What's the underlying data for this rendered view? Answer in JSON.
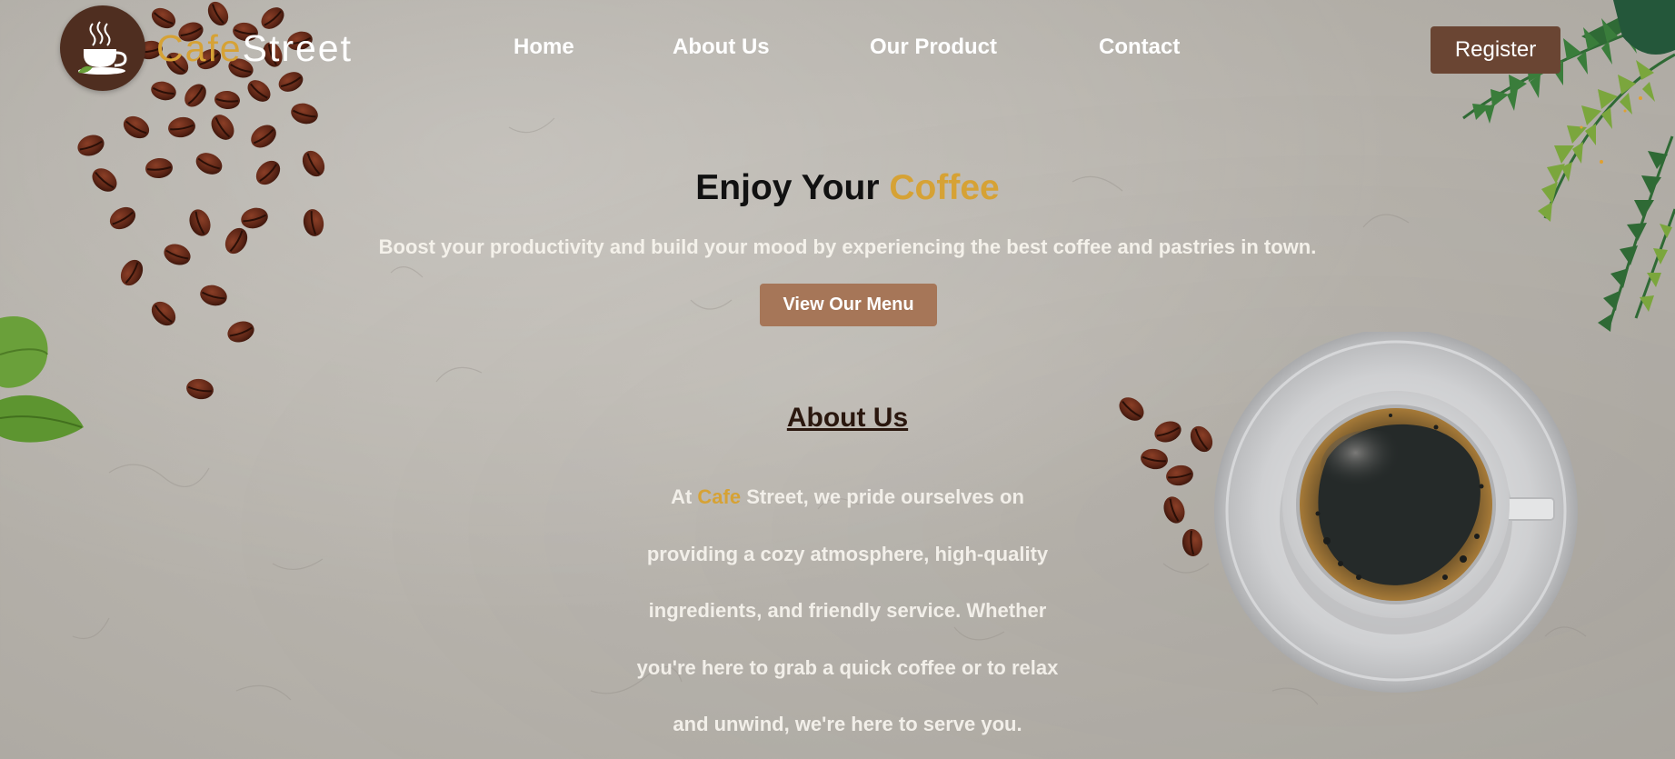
{
  "header": {
    "logo_part1": "Cafe",
    "logo_part2": "Street",
    "nav": [
      "Home",
      "About Us",
      "Our Product",
      "Contact"
    ],
    "register_label": "Register"
  },
  "hero": {
    "title_part1": "Enjoy Your ",
    "title_part2": "Coffee",
    "subtitle": "Boost your productivity and build your mood by experiencing the best coffee and pastries in town.",
    "cta_label": "View Our Menu"
  },
  "about": {
    "heading": "About Us",
    "line1_prefix": "At ",
    "line1_accent": "Cafe",
    "line1_suffix": " Street, we pride ourselves on",
    "line2": "providing a cozy atmosphere, high-quality",
    "line3": "ingredients, and friendly service. Whether",
    "line4": "you're here to grab a quick coffee or to relax",
    "line5": "and unwind, we're here to serve you."
  },
  "colors": {
    "brand_brown": "#4f2e20",
    "accent_gold": "#d6a235",
    "register_bg": "#6a4533",
    "menu_button_bg": "#a67658"
  },
  "icons": {
    "logo": "coffee-cup-icon"
  }
}
